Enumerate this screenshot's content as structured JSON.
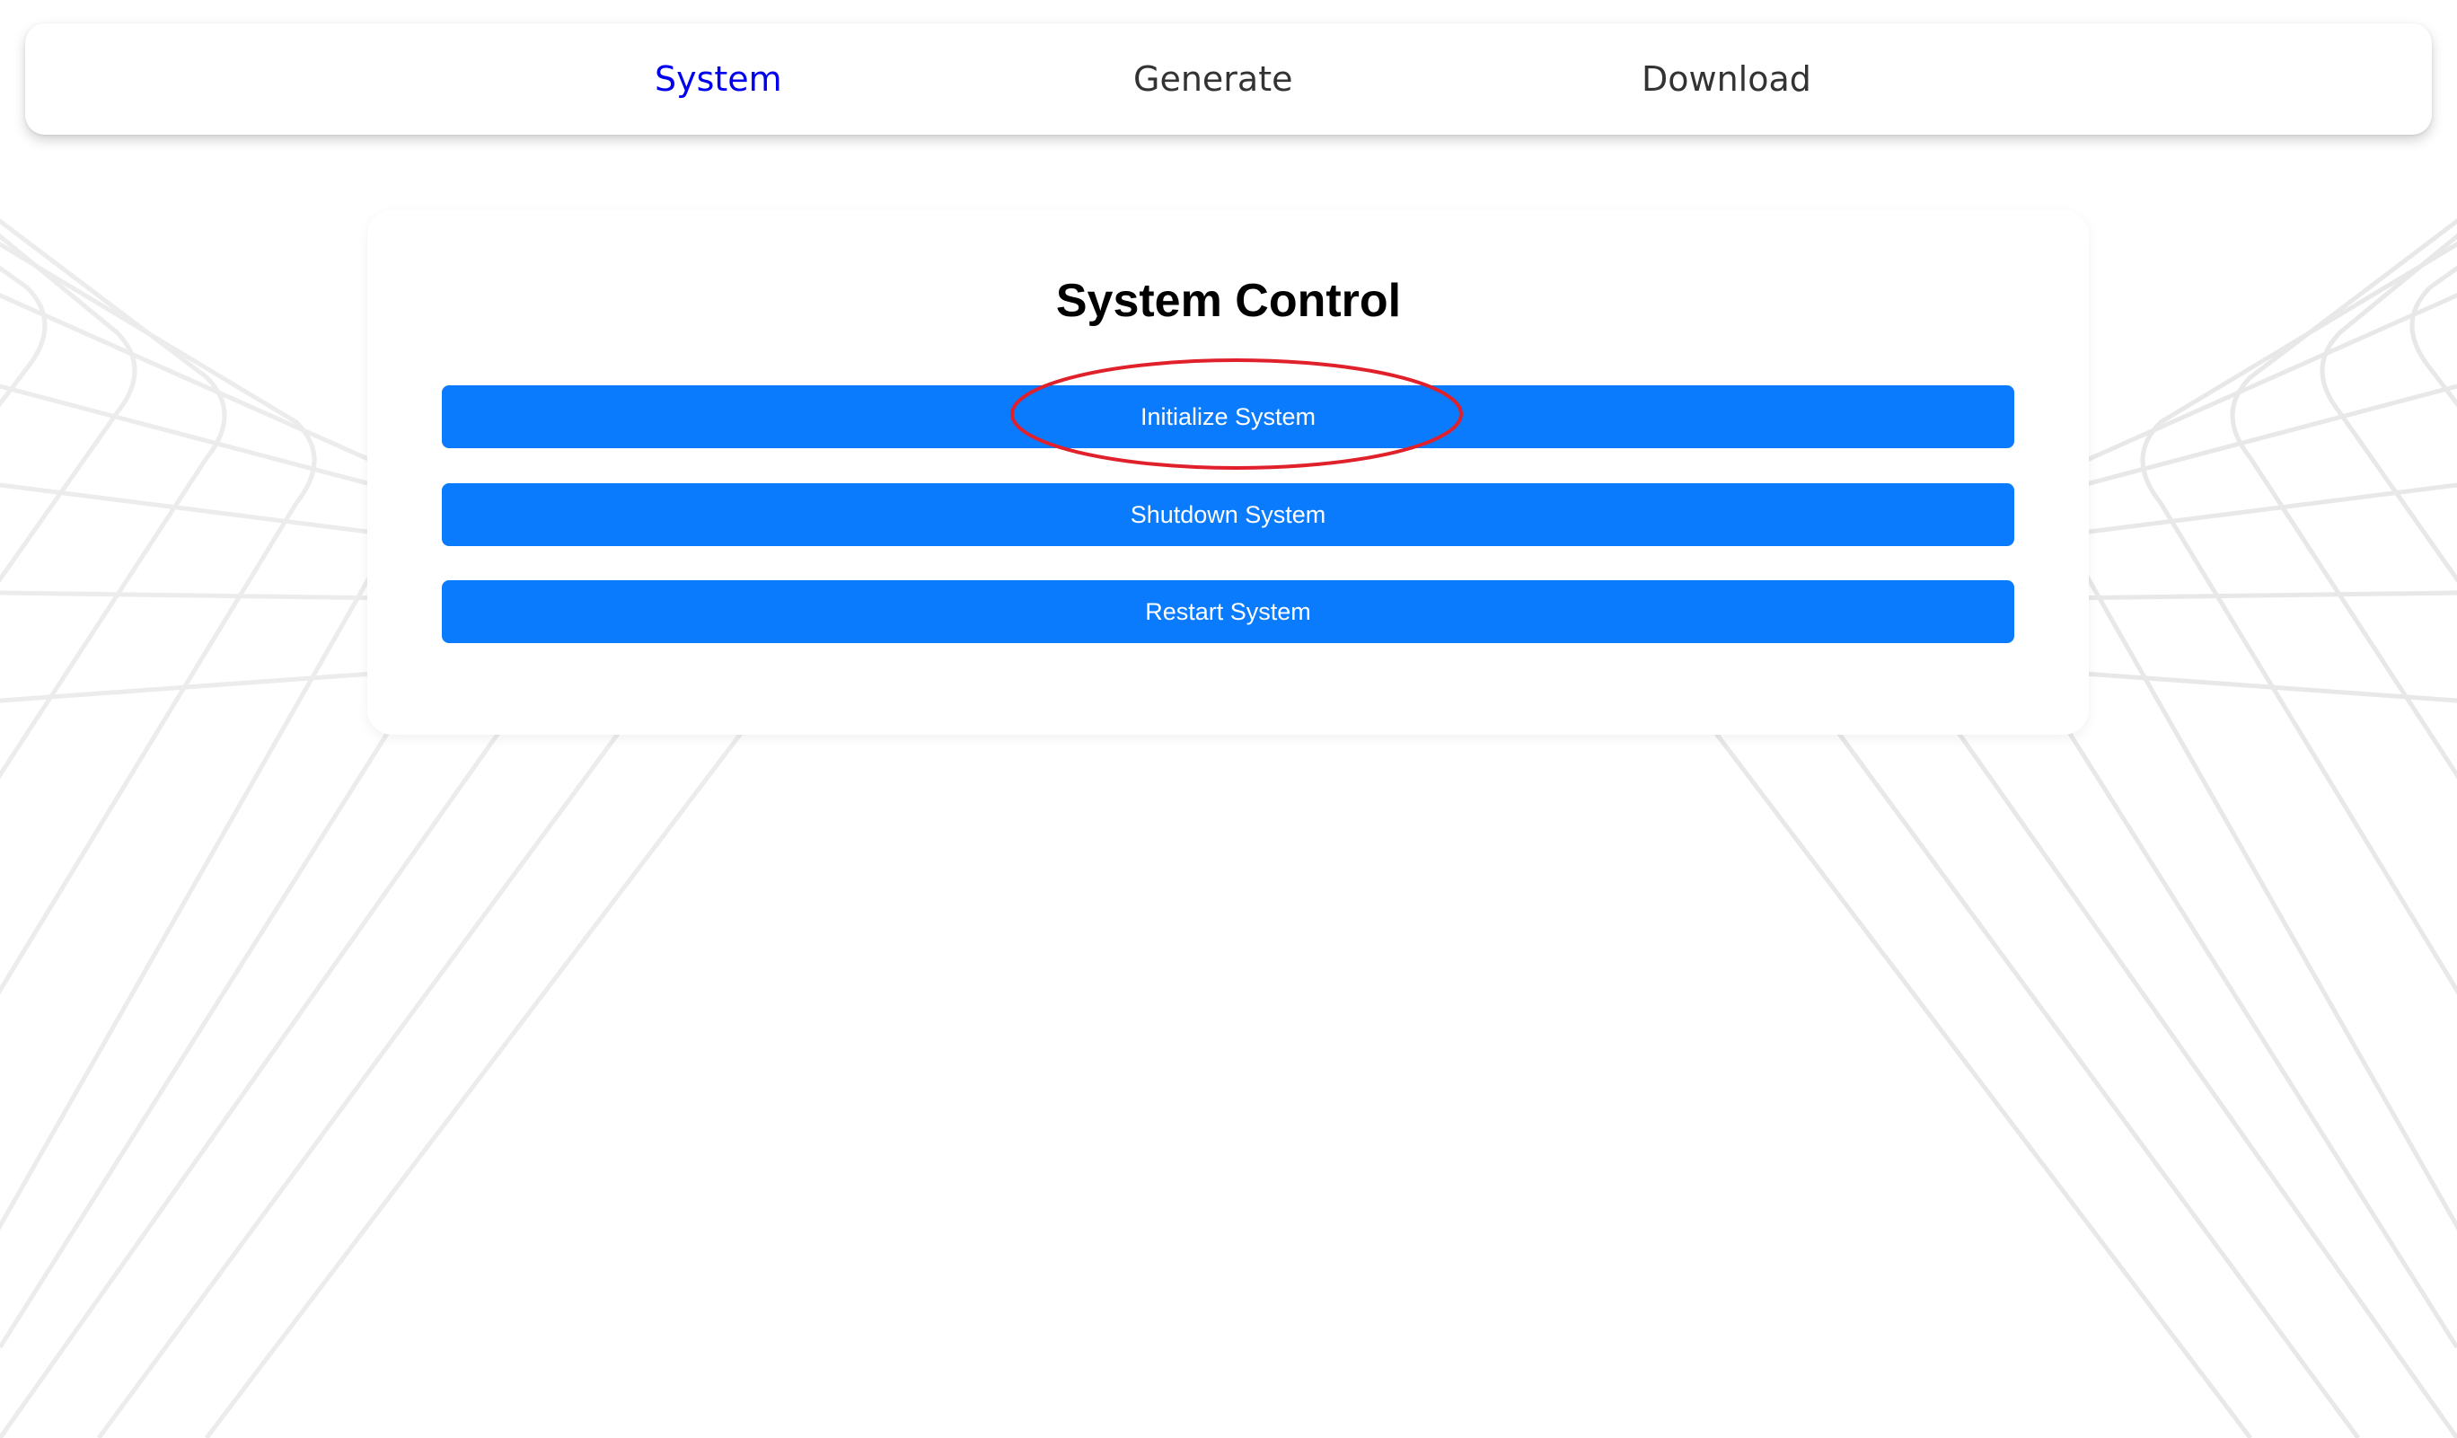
{
  "nav": {
    "items": [
      {
        "label": "System",
        "active": true
      },
      {
        "label": "Generate",
        "active": false
      },
      {
        "label": "Download",
        "active": false
      }
    ],
    "active_color": "#0000ee",
    "inactive_color": "#333333"
  },
  "panel": {
    "title": "System Control",
    "buttons": [
      {
        "label": "Initialize System"
      },
      {
        "label": "Shutdown System"
      },
      {
        "label": "Restart System"
      }
    ],
    "button_color": "#0a7bfd"
  },
  "annotation": {
    "shape": "ellipse",
    "target": "Initialize System",
    "color": "#e0202a"
  }
}
